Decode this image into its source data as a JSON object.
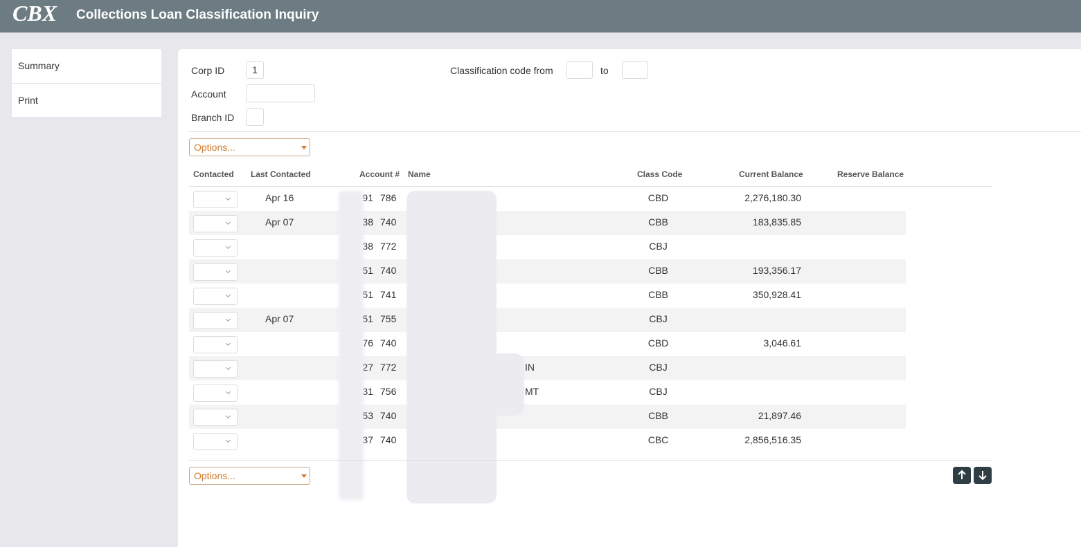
{
  "app": {
    "logo_text": "CBX",
    "title": "Collections Loan Classification Inquiry"
  },
  "sidebar": {
    "items": [
      {
        "label": "Summary"
      },
      {
        "label": "Print"
      }
    ]
  },
  "filters": {
    "corp_id_label": "Corp ID",
    "corp_id_value": "1",
    "account_label": "Account",
    "account_value": "",
    "branch_id_label": "Branch ID",
    "branch_id_value": "",
    "class_from_label": "Classification code from",
    "class_from_value": "",
    "class_to_label": "to",
    "class_to_value": ""
  },
  "options_label": "Options...",
  "table": {
    "columns": [
      "Contacted",
      "Last Contacted",
      "Account #",
      "Name",
      "Class Code",
      "Current Balance",
      "Reserve Balance"
    ],
    "rows": [
      {
        "contacted": "",
        "last_contacted": "Apr 16",
        "acct_prefix": "91",
        "acct_suffix": "786",
        "name": "",
        "class_code": "CBD",
        "current_balance": "2,276,180.30",
        "reserve_balance": ""
      },
      {
        "contacted": "",
        "last_contacted": "Apr 07",
        "acct_prefix": "38",
        "acct_suffix": "740",
        "name": "",
        "class_code": "CBB",
        "current_balance": "183,835.85",
        "reserve_balance": ""
      },
      {
        "contacted": "",
        "last_contacted": "",
        "acct_prefix": "38",
        "acct_suffix": "772",
        "name": "",
        "class_code": "CBJ",
        "current_balance": "",
        "reserve_balance": ""
      },
      {
        "contacted": "",
        "last_contacted": "",
        "acct_prefix": "51",
        "acct_suffix": "740",
        "name": "",
        "class_code": "CBB",
        "current_balance": "193,356.17",
        "reserve_balance": ""
      },
      {
        "contacted": "",
        "last_contacted": "",
        "acct_prefix": "51",
        "acct_suffix": "741",
        "name": "",
        "class_code": "CBB",
        "current_balance": "350,928.41",
        "reserve_balance": ""
      },
      {
        "contacted": "",
        "last_contacted": "Apr 07",
        "acct_prefix": "51",
        "acct_suffix": "755",
        "name": "",
        "class_code": "CBJ",
        "current_balance": "",
        "reserve_balance": ""
      },
      {
        "contacted": "",
        "last_contacted": "",
        "acct_prefix": "76",
        "acct_suffix": "740",
        "name": "",
        "class_code": "CBD",
        "current_balance": "3,046.61",
        "reserve_balance": ""
      },
      {
        "contacted": "",
        "last_contacted": "",
        "acct_prefix": "27",
        "acct_suffix": "772",
        "name": "IN",
        "class_code": "CBJ",
        "current_balance": "",
        "reserve_balance": ""
      },
      {
        "contacted": "",
        "last_contacted": "",
        "acct_prefix": "31",
        "acct_suffix": "756",
        "name": "MT",
        "class_code": "CBJ",
        "current_balance": "",
        "reserve_balance": ""
      },
      {
        "contacted": "",
        "last_contacted": "",
        "acct_prefix": "53",
        "acct_suffix": "740",
        "name": "",
        "class_code": "CBB",
        "current_balance": "21,897.46",
        "reserve_balance": ""
      },
      {
        "contacted": "",
        "last_contacted": "",
        "acct_prefix": "37",
        "acct_suffix": "740",
        "name": "",
        "class_code": "CBC",
        "current_balance": "2,856,516.35",
        "reserve_balance": ""
      }
    ]
  },
  "icons": {
    "scroll_up": "arrow-up-icon",
    "scroll_down": "arrow-down-icon",
    "select_chevron": "chevron-down-icon",
    "options_caret": "caret-down-icon"
  },
  "colors": {
    "header_bg": "#6c7c82",
    "accent_orange": "#d07a2a",
    "nav_button_bg": "#2f3e44"
  }
}
